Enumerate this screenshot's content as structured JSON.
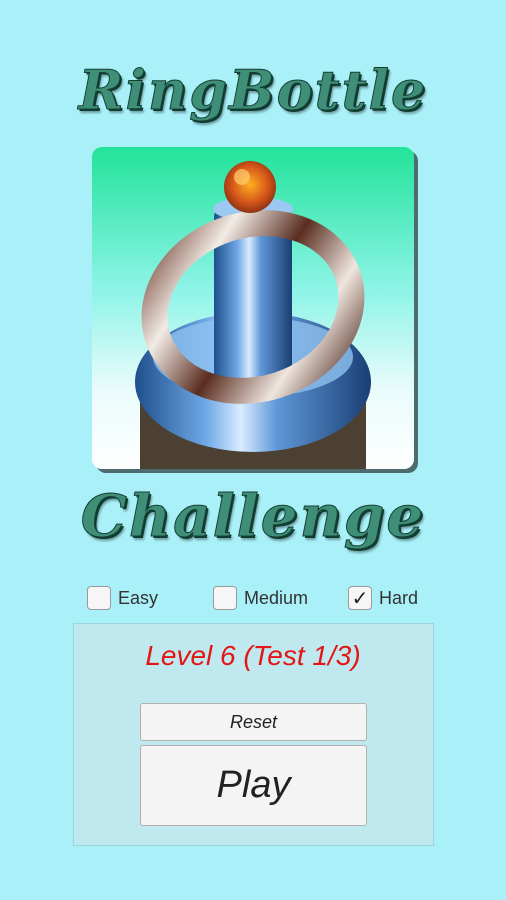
{
  "title": {
    "line1": "RingBottle",
    "line2": "Challenge"
  },
  "difficulty": {
    "options": [
      {
        "label": "Easy",
        "checked": false
      },
      {
        "label": "Medium",
        "checked": false
      },
      {
        "label": "Hard",
        "checked": true
      }
    ],
    "check_glyph": "✓"
  },
  "panel": {
    "level_text": "Level 6 (Test 1/3)",
    "reset_label": "Reset",
    "play_label": "Play"
  },
  "colors": {
    "background": "#a9f0f8",
    "title": "#3f8f78",
    "level_text": "#e31616",
    "panel": "#bfe9ee"
  }
}
